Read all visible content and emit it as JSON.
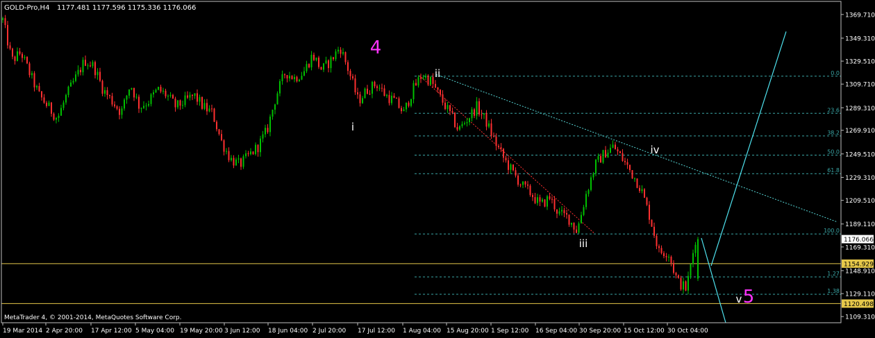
{
  "header": {
    "symbol": "GOLD-Pro,H4",
    "ohlc": "1177.481 1177.596 1175.336 1176.066"
  },
  "footer": {
    "copyright": "MetaTrader 4, © 2001-2014, MetaQuotes Software Corp."
  },
  "colors": {
    "background": "#000000",
    "frame": "#c0c0c0",
    "bull": "#00c000",
    "bear": "#ff3030",
    "grid": "#2f4f4f",
    "fib": "#3aa6a6",
    "trendline": "#58d8d8",
    "projection": "#4fe3ef",
    "hline": "#e6c84a",
    "wave_major": "#ff33ff",
    "wave_minor": "#ffffff"
  },
  "chart_data": {
    "type": "candlestick",
    "y_axis": {
      "range": [
        1104,
        1381
      ],
      "ticks": [
        "1369.710",
        "1349.310",
        "1329.510",
        "1309.710",
        "1289.310",
        "1269.910",
        "1249.510",
        "1229.310",
        "1209.510",
        "1189.110",
        "1169.310",
        "1148.910",
        "1129.110",
        "1109.310"
      ]
    },
    "x_axis": {
      "ticks": [
        "19 Mar 2014",
        "2 Apr 20:00",
        "17 Apr 12:00",
        "5 May 04:00",
        "19 May 20:00",
        "3 Jun 12:00",
        "18 Jun 04:00",
        "2 Jul 20:00",
        "17 Jul 12:00",
        "1 Aug 04:00",
        "15 Aug 20:00",
        "1 Sep 12:00",
        "16 Sep 04:00",
        "30 Sep 20:00",
        "15 Oct 12:00",
        "30 Oct 04:00"
      ]
    },
    "price_path": [
      1365,
      1330,
      1337,
      1318,
      1300,
      1290,
      1280,
      1300,
      1315,
      1330,
      1325,
      1305,
      1295,
      1285,
      1310,
      1290,
      1295,
      1305,
      1300,
      1290,
      1295,
      1300,
      1290,
      1285,
      1260,
      1245,
      1240,
      1248,
      1256,
      1270,
      1300,
      1320,
      1315,
      1320,
      1335,
      1322,
      1330,
      1342,
      1320,
      1295,
      1305,
      1310,
      1300,
      1295,
      1285,
      1305,
      1318,
      1312,
      1298,
      1285,
      1270,
      1280,
      1290,
      1278,
      1260,
      1245,
      1233,
      1222,
      1215,
      1205,
      1212,
      1198,
      1195,
      1183,
      1215,
      1240,
      1250,
      1256,
      1245,
      1233,
      1220,
      1195,
      1165,
      1165,
      1140,
      1133,
      1176
    ],
    "current_price": 1176.066,
    "price_labels": [
      {
        "label": "1176.066",
        "value": 1176.066
      },
      {
        "label": "1154.929",
        "value": 1154.929
      },
      {
        "label": "1120.498",
        "value": 1120.498
      }
    ],
    "horizontal_lines": [
      1154.929,
      1120.498
    ],
    "fibonacci": {
      "levels": [
        {
          "label": "0.0",
          "value": 1316.5
        },
        {
          "label": "23.6",
          "value": 1284.5
        },
        {
          "label": "38.2",
          "value": 1265.0
        },
        {
          "label": "50.0",
          "value": 1248.5
        },
        {
          "label": "61.8",
          "value": 1232.5
        },
        {
          "label": "100.0",
          "value": 1180.5
        },
        {
          "label": "1.27",
          "value": 1143.5
        },
        {
          "label": "1.38",
          "value": 1128.5
        }
      ]
    },
    "wave_labels": [
      {
        "text": "4",
        "kind": "major"
      },
      {
        "text": "ii",
        "kind": "minor"
      },
      {
        "text": "i",
        "kind": "minor"
      },
      {
        "text": "iii",
        "kind": "minor"
      },
      {
        "text": "iv",
        "kind": "minor"
      },
      {
        "text": "v",
        "kind": "minor"
      },
      {
        "text": "5",
        "kind": "major"
      }
    ]
  }
}
